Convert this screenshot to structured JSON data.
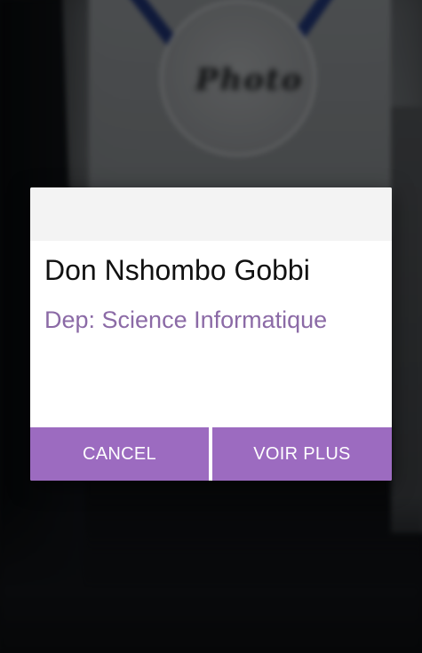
{
  "dialog": {
    "name": "Don Nshombo Gobbi",
    "department": "Dep: Science Informatique",
    "cancel_label": "CANCEL",
    "more_label": "VOIR PLUS"
  },
  "background": {
    "photo_placeholder_text": "Photo"
  },
  "colors": {
    "accent": "#9c6bc0",
    "department_text": "#8b6aa6",
    "dialog_header": "#f3f3f3"
  }
}
